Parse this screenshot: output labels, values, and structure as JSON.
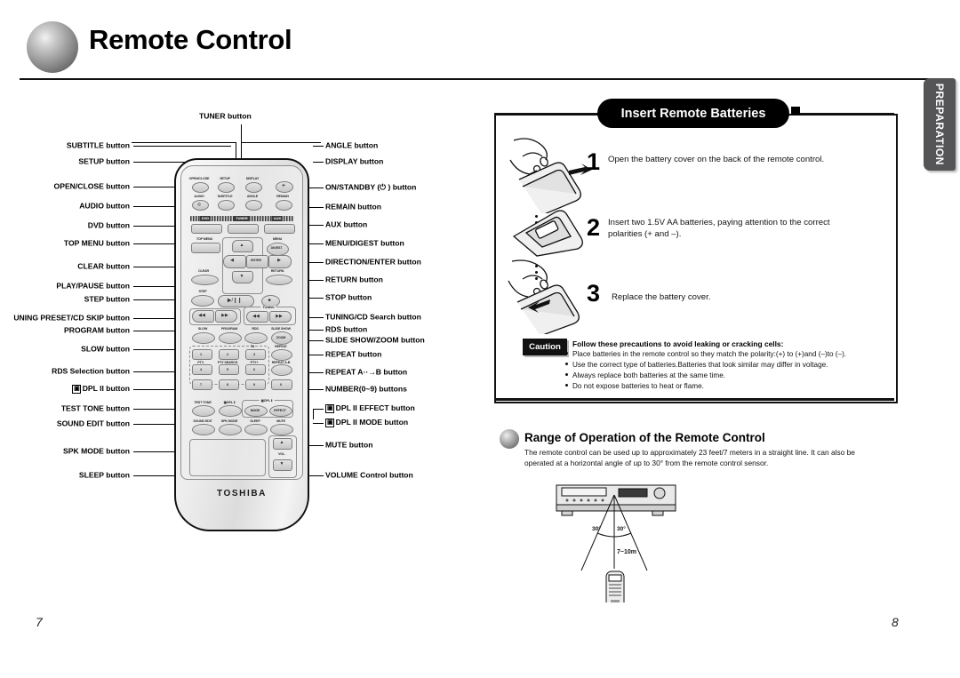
{
  "header": {
    "title": "Remote Control",
    "ball_icon": "gray-sphere-bullet-icon"
  },
  "side_tab": {
    "label": "PREPARATION"
  },
  "page_numbers": {
    "left": "7",
    "right": "8"
  },
  "remote": {
    "brand": "TOSHIBA",
    "top_label": "TUNER button",
    "source_labels": [
      "DVD",
      "TUNER",
      "AUX"
    ],
    "face_captions": [
      "OPEN/CLOSE",
      "SETUP",
      "DISPLAY",
      "AUDIO",
      "SUBTITLE",
      "ANGLE",
      "REMAIN",
      "TOP MENU",
      "MENU",
      "DIGEST",
      "ENTER",
      "CLEAR",
      "RETURN",
      "STEP",
      "TUNING",
      "SLOW",
      "PROGRAM",
      "RDS",
      "SLIDE SHOW",
      "ZOOM",
      "REPEAT",
      "REPEAT A-B",
      "TA",
      "PTY-",
      "PTY SEARCH",
      "PTY+",
      "TEST TONE",
      "DPL Ⅱ",
      "MODE",
      "EFFECT",
      "SOUND EDIT",
      "SPK MODE",
      "SLEEP",
      "MUTE",
      "VOL"
    ],
    "keypad": [
      "1",
      "2",
      "3",
      "4",
      "5",
      "6",
      "7",
      "8",
      "9",
      "0"
    ]
  },
  "callouts": {
    "left": [
      {
        "text": "SUBTITLE  button"
      },
      {
        "text": "SETUP button"
      },
      {
        "text": "OPEN/CLOSE button"
      },
      {
        "text": "AUDIO button"
      },
      {
        "text": "DVD button"
      },
      {
        "text": "TOP MENU button"
      },
      {
        "text": "CLEAR button"
      },
      {
        "text": "PLAY/PAUSE button"
      },
      {
        "text": "STEP button"
      },
      {
        "text": "UNING PRESET/CD SKIP button"
      },
      {
        "text": "PROGRAM button"
      },
      {
        "text": "SLOW button"
      },
      {
        "text": "RDS Selection button"
      },
      {
        "text": "DPL II button",
        "dolby": true
      },
      {
        "text": "TEST TONE button"
      },
      {
        "text": "SOUND EDIT button"
      },
      {
        "text": "SPK MODE button"
      },
      {
        "text": "SLEEP button"
      }
    ],
    "right": [
      {
        "text": "ANGLE button"
      },
      {
        "text": "DISPLAY button"
      },
      {
        "text": "ON/STANDBY (⏻ ) button"
      },
      {
        "text": "REMAIN button"
      },
      {
        "text": "AUX button"
      },
      {
        "text": "MENU/DIGEST button"
      },
      {
        "text": "DIRECTION/ENTER button"
      },
      {
        "text": "RETURN button"
      },
      {
        "text": "STOP button"
      },
      {
        "text": "TUNING/CD Search button"
      },
      {
        "text": "RDS button"
      },
      {
        "text": "SLIDE SHOW/ZOOM button"
      },
      {
        "text": "REPEAT button"
      },
      {
        "text": "REPEAT A··→B button"
      },
      {
        "text": "NUMBER(0~9) buttons"
      },
      {
        "text": "DPL II EFFECT button",
        "dolby": true
      },
      {
        "text": "DPL II MODE button",
        "dolby": true
      },
      {
        "text": "MUTE button"
      },
      {
        "text": "VOLUME Control button"
      }
    ]
  },
  "battery_panel": {
    "title": "Insert Remote Batteries",
    "steps": [
      {
        "num": "1",
        "text": "Open the battery cover on the back of the remote control."
      },
      {
        "num": "2",
        "text": "Insert two 1.5V AA batteries, paying attention to the correct polarities (+ and –)."
      },
      {
        "num": "3",
        "text": "Replace the battery cover."
      }
    ],
    "caution_label": "Caution",
    "caution_heading": "Follow these precautions to avoid leaking or cracking cells:",
    "caution_items": [
      "Place batteries in the remote control so they match the polarity:(+) to (+)and (–)to (–).",
      "Use the correct type of batteries.Batteries that look similar may differ in voltage.",
      "Always replace both batteries at the same time.",
      "Do not expose batteries to heat or flame."
    ]
  },
  "range_section": {
    "title": "Range of Operation of the Remote Control",
    "body": "The remote control can be used up to approximately 23 feet/7 meters in a straight line. It can also be operated at a horizontal angle of up to 30° from the remote control sensor.",
    "diagram": {
      "angle_left": "30°",
      "angle_right": "30°",
      "distance": "7~10m"
    }
  }
}
